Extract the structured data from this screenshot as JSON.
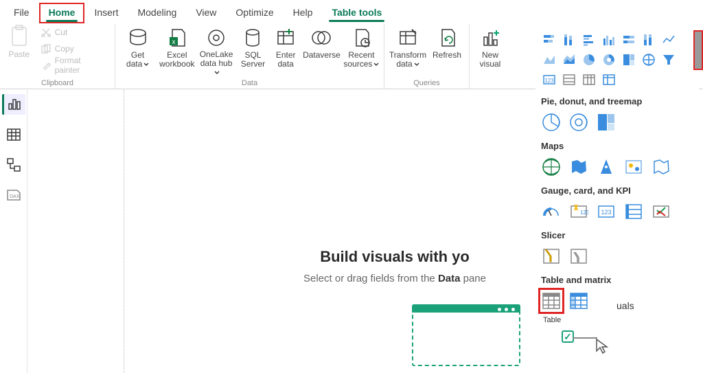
{
  "tabs": {
    "file": "File",
    "home": "Home",
    "insert": "Insert",
    "modeling": "Modeling",
    "view": "View",
    "optimize": "Optimize",
    "help": "Help",
    "table": "Table tools"
  },
  "ribbon": {
    "clipboard": {
      "paste": "Paste",
      "cut": "Cut",
      "copy": "Copy",
      "format": "Format painter",
      "group": "Clipboard"
    },
    "data": {
      "getdata": {
        "l1": "Get",
        "l2": "data"
      },
      "excel": {
        "l1": "Excel",
        "l2": "workbook"
      },
      "onelake": {
        "l1": "OneLake",
        "l2": "data hub"
      },
      "sql": {
        "l1": "SQL",
        "l2": "Server"
      },
      "enter": {
        "l1": "Enter",
        "l2": "data"
      },
      "dataverse": {
        "l1": "Dataverse",
        "l2": ""
      },
      "recent": {
        "l1": "Recent",
        "l2": "sources"
      },
      "group": "Data"
    },
    "queries": {
      "transform": {
        "l1": "Transform",
        "l2": "data"
      },
      "refresh": {
        "l1": "Refresh",
        "l2": ""
      },
      "group": "Queries"
    },
    "insert": {
      "newvisual": {
        "l1": "New",
        "l2": "visual"
      }
    }
  },
  "vispane": {
    "sect_pie": "Pie, donut, and treemap",
    "sect_maps": "Maps",
    "sect_gauge": "Gauge, card, and KPI",
    "sect_slicer": "Slicer",
    "sect_table": "Table and matrix",
    "tooltip_table": "Table",
    "other_label": "uals"
  },
  "canvas": {
    "heading": "Build visuals with yo",
    "sub_pre": "Select or drag fields from the ",
    "sub_bold": "Data",
    "sub_post": " pane"
  }
}
